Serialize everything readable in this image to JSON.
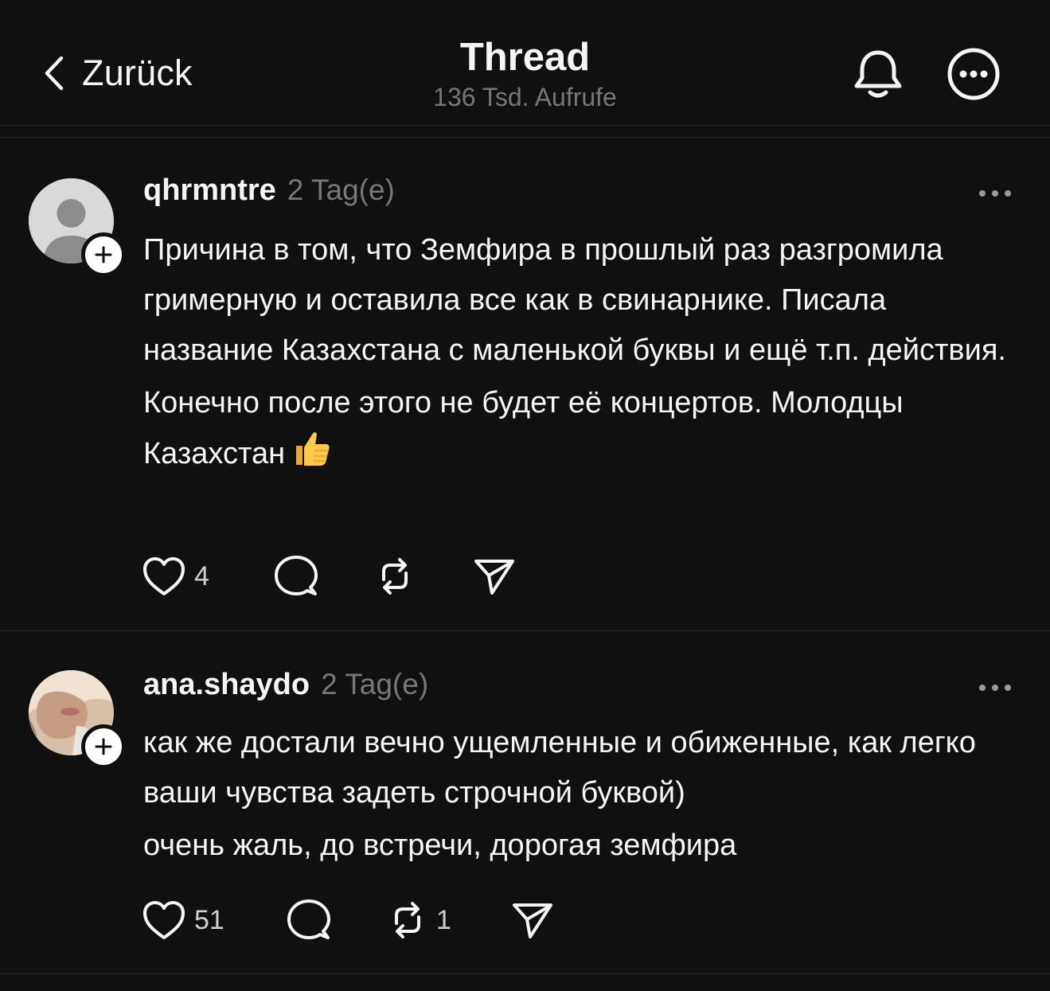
{
  "header": {
    "back_label": "Zurück",
    "title": "Thread",
    "subtitle": "136 Tsd. Aufrufe"
  },
  "icons": {
    "back": "chevron-left-icon",
    "notifications": "bell-icon",
    "menu": "more-circle-icon",
    "like": "heart-icon",
    "reply": "comment-icon",
    "repost": "repost-icon",
    "share": "send-icon"
  },
  "posts": [
    {
      "username": "qhrmntre",
      "timestamp": "2 Tag(e)",
      "paragraphs": [
        "Причина в том, что Земфира в прошлый раз разгромила гримерную и оставила все как в свинарнике. Писала название Казахстана с маленькой буквы и ещё т.п. действия.",
        "Конечно после этого не будет её концертов. Молодцы Казахстан"
      ],
      "emoji": "👍",
      "likes": "4",
      "replies": "",
      "reposts": "",
      "avatar": "default-avatar"
    },
    {
      "username": "ana.shaydo",
      "timestamp": "2 Tag(e)",
      "paragraphs": [
        "как же достали вечно ущемленные и обиженные, как легко ваши чувства задеть строчной буквой)",
        "очень жаль, до встречи, дорогая земфира"
      ],
      "likes": "51",
      "replies": "",
      "reposts": "1",
      "avatar": "photo-avatar"
    }
  ],
  "colors": {
    "background": "#101010",
    "text": "#f3f5f7",
    "secondary_text": "#777777",
    "divider": "#2a2a2a"
  }
}
